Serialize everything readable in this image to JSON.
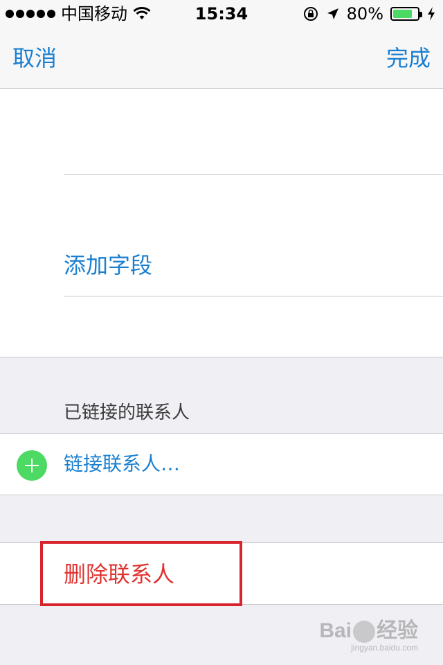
{
  "status_bar": {
    "carrier": "中国移动",
    "time": "15:34",
    "battery_percent": "80%",
    "battery_level": 0.8,
    "signal_icon": "signal-dots-icon",
    "wifi_icon": "wifi-icon",
    "lock_icon": "orientation-lock-icon",
    "location_icon": "location-arrow-icon",
    "charging_icon": "charging-bolt-icon"
  },
  "nav": {
    "cancel_label": "取消",
    "done_label": "完成"
  },
  "fields": {
    "add_field_label": "添加字段"
  },
  "linked_contacts": {
    "header": "已链接的联系人",
    "link_label": "链接联系人…",
    "add_icon": "plus-circle-icon",
    "add_icon_color": "#4cd964"
  },
  "delete": {
    "label": "删除联系人",
    "color": "#e0332f"
  },
  "annotation": {
    "highlight_color": "#d8252d"
  },
  "watermark": {
    "main_left": "Bai",
    "main_right": "经验",
    "sub": "jingyan.baidu.com"
  },
  "colors": {
    "accent": "#1a7fd0",
    "background": "#efeff4"
  }
}
